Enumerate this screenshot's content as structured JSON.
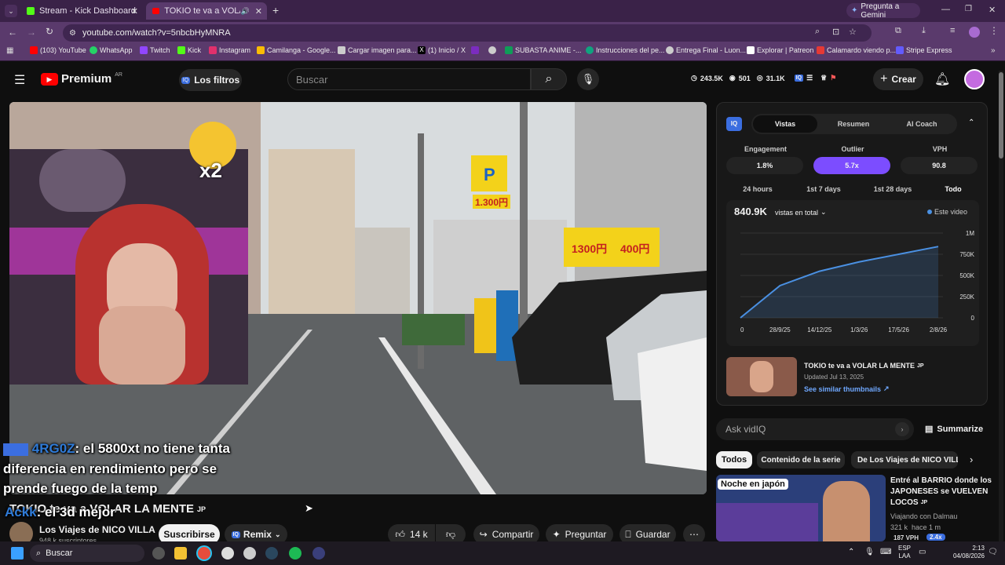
{
  "browser": {
    "tabs": [
      {
        "label": "Stream - Kick Dashboard"
      },
      {
        "label": "TOKIO te va a VOLAR LA M..."
      }
    ],
    "gemini_label": "Pregunta a Gemini",
    "url": "youtube.com/watch?v=5nbcbHyMNRA",
    "bookmarks": [
      {
        "label": "(103) YouTube",
        "color": "#ff0000"
      },
      {
        "label": "WhatsApp",
        "color": "#25d366"
      },
      {
        "label": "Twitch",
        "color": "#9146ff"
      },
      {
        "label": "Kick",
        "color": "#53fc18"
      },
      {
        "label": "Instagram",
        "color": "#e1306c"
      },
      {
        "label": "Camilanga - Google...",
        "color": "#fbbc04"
      },
      {
        "label": "Cargar imagen para...",
        "color": "#cccccc"
      },
      {
        "label": "(1) Inicio / X",
        "color": "#000000"
      },
      {
        "label": "",
        "color": "#7b2cbf"
      },
      {
        "label": "",
        "color": "#cccccc"
      },
      {
        "label": "SUBASTA ANIME -...",
        "color": "#0f9d58"
      },
      {
        "label": "Instrucciones del pe...",
        "color": "#10a37f"
      },
      {
        "label": "Entrega Final - Luon...",
        "color": "#cccccc"
      },
      {
        "label": "Explorar | Patreon",
        "color": "#ffffff"
      },
      {
        "label": "Calamardo viendo p...",
        "color": "#e53935"
      },
      {
        "label": "Stripe Express",
        "color": "#635bff"
      }
    ]
  },
  "youtube": {
    "logo": "Premium",
    "region": "AR",
    "filters_label": "Los filtros",
    "search_placeholder": "Buscar",
    "stats": {
      "views": "243.5K",
      "eye": "501",
      "subs": "31.1K"
    },
    "create_label": "Crear"
  },
  "overlay": {
    "multiplier": "x2",
    "chat": [
      {
        "user": "4RG0Z",
        "text": ": el 5800xt no tiene tanta"
      },
      {
        "user": "",
        "text": "diferencia en rendimiento pero se"
      },
      {
        "user": "",
        "text": "prende fuego de la temp"
      },
      {
        "user": "Ackk",
        "text": ": el 3d mejor"
      }
    ],
    "signs": {
      "price_a": "1.300円",
      "price_b": "1300円",
      "price_c": "400円"
    }
  },
  "video_info": {
    "title": "TOKIO te va a VOLAR LA MENTE",
    "title_suffix": "JP",
    "channel": "Los Viajes de NICO VILLA",
    "subscribers": "948 k suscriptores",
    "subscribe_label": "Suscribirse",
    "remix_label": "Remix",
    "likes": "14 k",
    "share_label": "Compartir",
    "ask_label": "Preguntar",
    "save_label": "Guardar"
  },
  "vidiq": {
    "tabs": [
      "Vistas",
      "Resumen",
      "AI Coach"
    ],
    "active_tab": "Vistas",
    "metrics": [
      {
        "label": "Engagement",
        "value": "1.8%"
      },
      {
        "label": "Outlier",
        "value": "5.7x"
      },
      {
        "label": "VPH",
        "value": "90.8"
      }
    ],
    "ranges": [
      "24 hours",
      "1st 7 days",
      "1st 28 days",
      "Todo"
    ],
    "active_range": "Todo",
    "total_views": "840.9K",
    "views_dropdown": "vistas en total",
    "legend": "Este video",
    "accent": "#7c4dff",
    "line_color": "#4a90e2",
    "chart_data": {
      "type": "line",
      "x": [
        "0",
        "28/9/25",
        "14/12/25",
        "1/3/26",
        "17/5/26",
        "2/8/26"
      ],
      "y_ticks": [
        "1M",
        "750K",
        "500K",
        "250K",
        "0"
      ],
      "series": [
        {
          "name": "Este video",
          "values": [
            0,
            380000,
            550000,
            660000,
            750000,
            840900
          ]
        }
      ],
      "ylim": [
        0,
        1000000
      ]
    },
    "video_card": {
      "title": "TOKIO te va a VOLAR LA MENTE",
      "suffix": "JP",
      "updated": "Updated Jul 13, 2025",
      "link": "See similar thumbnails"
    }
  },
  "sidebar": {
    "ask_placeholder": "Ask vidIQ",
    "summarize_label": "Summarize",
    "chips": [
      "Todos",
      "Contenido de la serie",
      "De Los Viajes de NICO VILLA"
    ],
    "recommendation": {
      "thumb_text": "Noche en japón",
      "title_line1": "Entré al BARRIO donde los",
      "title_line2": "JAPONESES se VUELVEN",
      "title_line3": "LOCOS",
      "suffix": "JP",
      "channel": "Viajando con Dalmau",
      "meta": "321 k  hace 1 m",
      "vph": "187 VPH",
      "badge": "2.4x"
    }
  },
  "taskbar": {
    "search_label": "Buscar",
    "lang_line1": "ESP",
    "lang_line2": "LAA",
    "time": "2:13",
    "date": "04/08/2026"
  }
}
